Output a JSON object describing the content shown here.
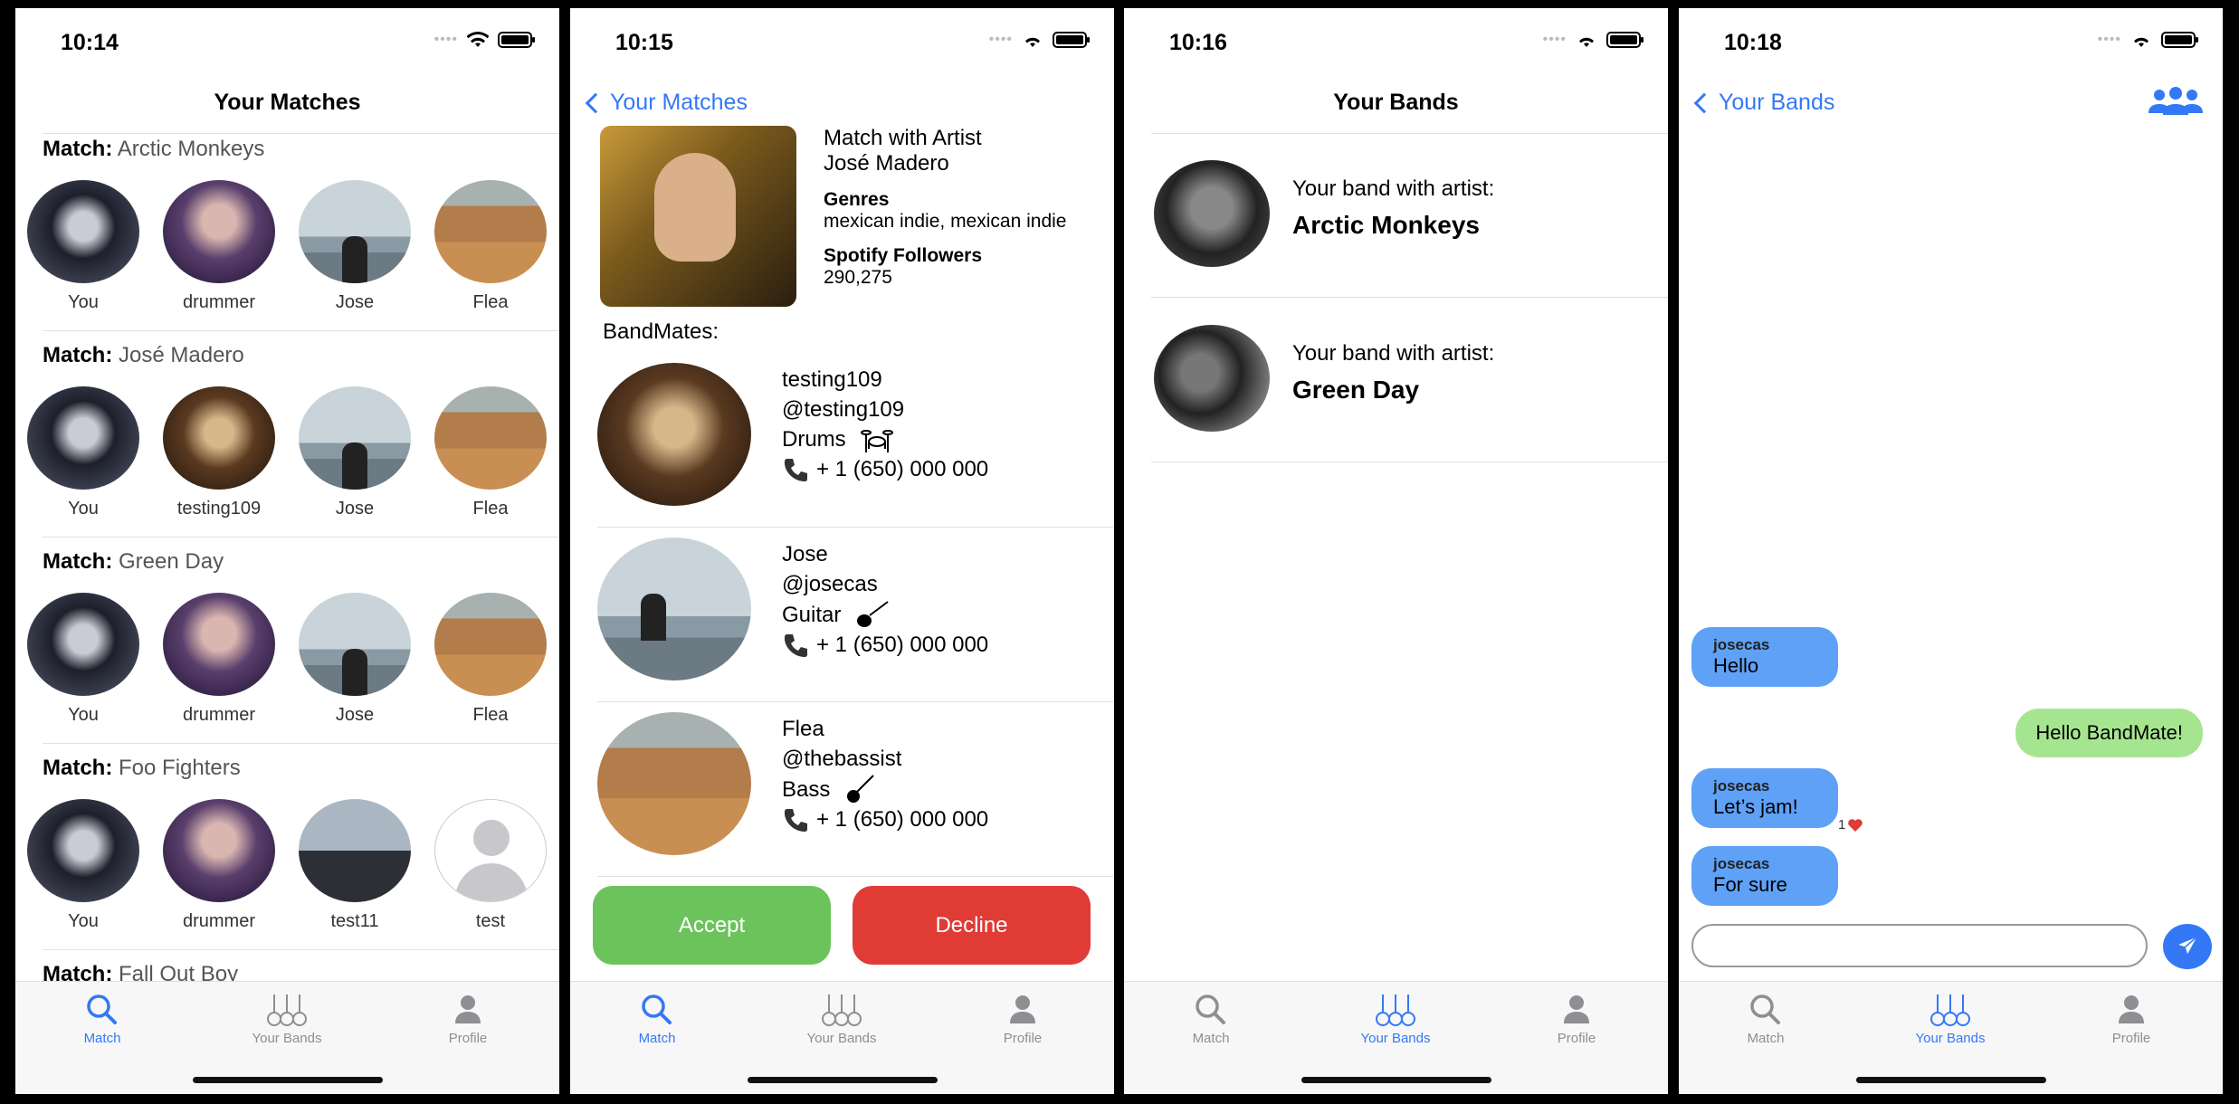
{
  "tabbar": {
    "match": "Match",
    "bands": "Your Bands",
    "profile": "Profile"
  },
  "screen1": {
    "time": "10:14",
    "title": "Your Matches",
    "match_label": "Match:",
    "sections": [
      {
        "artist": "Arctic Monkeys",
        "members": [
          "You",
          "drummer",
          "Jose",
          "Flea"
        ]
      },
      {
        "artist": "José Madero",
        "members": [
          "You",
          "testing109",
          "Jose",
          "Flea"
        ]
      },
      {
        "artist": "Green Day",
        "members": [
          "You",
          "drummer",
          "Jose",
          "Flea"
        ]
      },
      {
        "artist": "Foo Fighters",
        "members": [
          "You",
          "drummer",
          "test11",
          "test"
        ]
      },
      {
        "artist": "Fall Out Boy"
      }
    ]
  },
  "screen2": {
    "time": "10:15",
    "back": "Your Matches",
    "match_with": "Match with Artist",
    "artist": "José Madero",
    "genres_label": "Genres",
    "genres": "mexican indie, mexican indie",
    "followers_label": "Spotify Followers",
    "followers": "290,275",
    "bandmates_label": "BandMates:",
    "bandmates": [
      {
        "name": "testing109",
        "handle": "@testing109",
        "role": "Drums",
        "phone": "+ 1 (650) 000 000"
      },
      {
        "name": "Jose",
        "handle": "@josecas",
        "role": "Guitar",
        "phone": "+ 1 (650) 000 000"
      },
      {
        "name": "Flea",
        "handle": "@thebassist",
        "role": "Bass",
        "phone": "+ 1 (650) 000 000"
      }
    ],
    "accept": "Accept",
    "decline": "Decline",
    "colors": {
      "accept": "#6cc35c",
      "decline": "#e03b35"
    }
  },
  "screen3": {
    "time": "10:16",
    "title": "Your Bands",
    "bands": [
      {
        "label": "Your band with artist:",
        "artist": "Arctic Monkeys"
      },
      {
        "label": "Your band with artist:",
        "artist": "Green Day"
      }
    ]
  },
  "screen4": {
    "time": "10:18",
    "back": "Your Bands",
    "messages": [
      {
        "user": "josecas",
        "text": "Hello"
      },
      {
        "me": "Hello BandMate!"
      },
      {
        "user": "josecas",
        "text": "Let’s jam!",
        "reaction_count": "1"
      },
      {
        "user": "josecas",
        "text": "For sure"
      }
    ],
    "input_placeholder": ""
  }
}
